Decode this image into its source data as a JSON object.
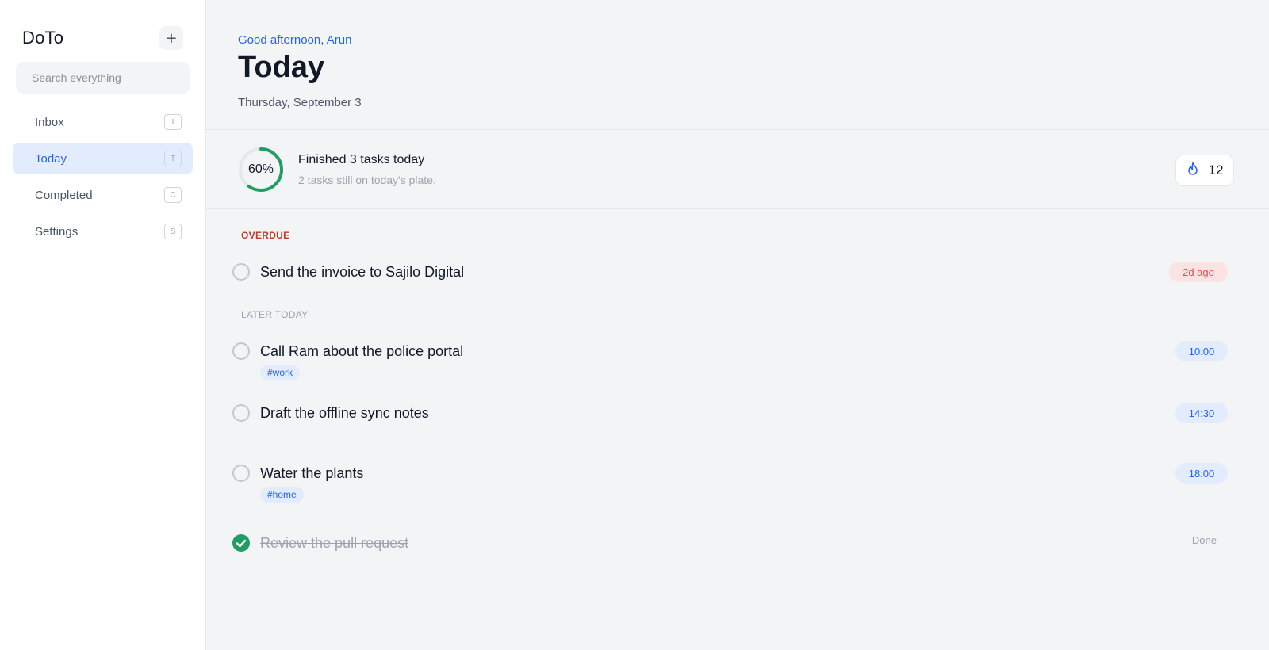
{
  "app": {
    "name": "DoTo",
    "add_label": "+"
  },
  "search": {
    "placeholder": "Search everything"
  },
  "nav": {
    "items": [
      {
        "label": "Inbox",
        "shortcut": "I",
        "active": false
      },
      {
        "label": "Today",
        "shortcut": "T",
        "active": true
      },
      {
        "label": "Completed",
        "shortcut": "C",
        "active": false
      },
      {
        "label": "Settings",
        "shortcut": "S",
        "active": false
      }
    ]
  },
  "header": {
    "greeting": "Good afternoon, Arun",
    "title": "Today",
    "date": "Thursday, September 3"
  },
  "progress": {
    "percent_label": "60%",
    "percent": 60,
    "title": "Finished 3 tasks today",
    "subtitle": "2 tasks still on today's plate.",
    "streak_icon": "flame-icon",
    "streak_count": "12"
  },
  "sections": {
    "overdue": {
      "label": "OVERDUE",
      "tasks": [
        {
          "title": "Send the invoice to Sajilo Digital",
          "badge": "2d ago"
        }
      ]
    },
    "later": {
      "label": "LATER TODAY",
      "tasks": [
        {
          "title": "Call Ram about the police portal",
          "tag": "#work",
          "time": "10:00"
        },
        {
          "title": "Draft the offline sync notes",
          "time": "14:30"
        },
        {
          "title": "Water the plants",
          "tag": "#home",
          "time": "18:00"
        },
        {
          "title": "Review the pull request",
          "status": "Done",
          "done": true
        }
      ]
    }
  },
  "colors": {
    "accent": "#2563eb",
    "success": "#1f9d63",
    "danger": "#c0392b",
    "active_bg": "#e3ecfc"
  }
}
